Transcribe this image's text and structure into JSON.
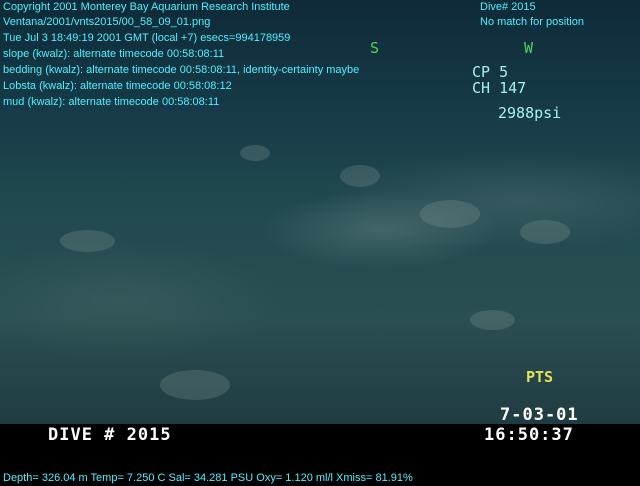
{
  "header": {
    "copyright": "Copyright 2001 Monterey Bay Aquarium Research Institute",
    "file_path": "Ventana/2001/vnts2015/00_58_09_01.png",
    "timestamp": "Tue Jul  3 18:49:19 2001 GMT (local +7)  esecs=994178959",
    "dive": "Dive# 2015",
    "position_status": "No match for position"
  },
  "annotations": [
    "slope (kwalz): alternate timecode 00:58:08:11",
    "bedding (kwalz): alternate timecode 00:58:08:11, identity-certainty maybe",
    "Lobsta (kwalz): alternate timecode 00:58:08:12",
    "mud (kwalz): alternate timecode 00:58:08:11"
  ],
  "camera_overlay": {
    "compass_s": "S",
    "compass_w": "W",
    "cp": "CP   5",
    "ch": "CH 147",
    "pressure": "2988psi",
    "pts": "PTS",
    "date": "7-03-01",
    "dive_label": "DIVE # 2015",
    "time": "16:50:37"
  },
  "footer": {
    "telemetry": "Depth= 326.04 m  Temp= 7.250 C  Sal= 34.281 PSU  Oxy= 1.120 ml/l  Xmiss= 81.91%"
  }
}
